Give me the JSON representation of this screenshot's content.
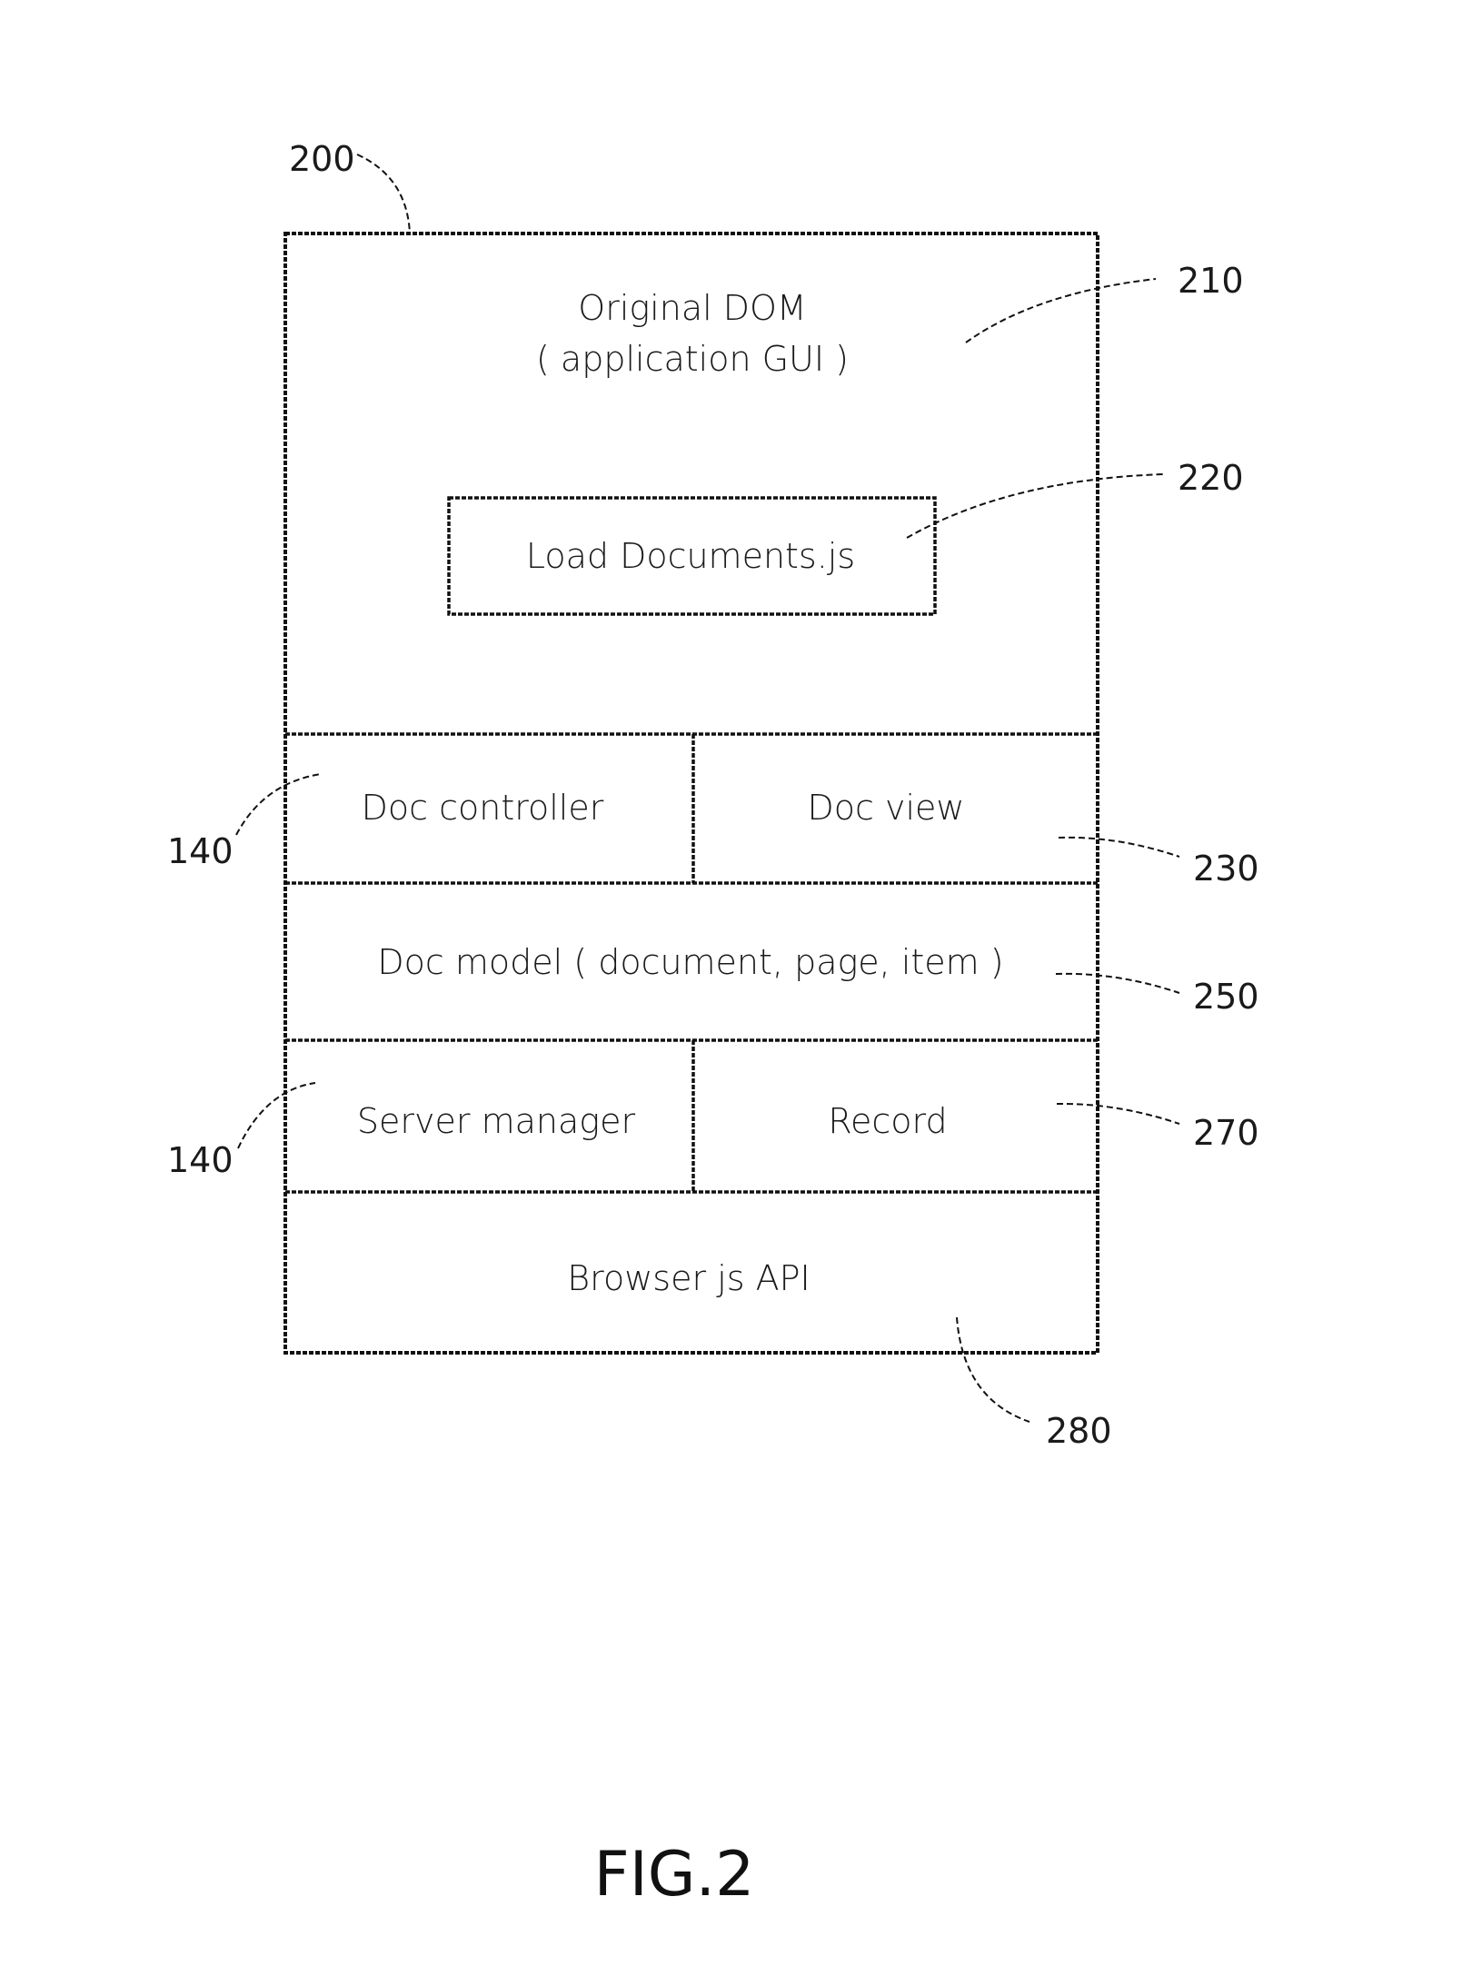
{
  "figure": {
    "caption": "FIG.2",
    "container_ref": "200",
    "original_dom": {
      "line1": "Original DOM",
      "line2": "( application GUI )",
      "ref": "210"
    },
    "load_documents": {
      "label": "Load Documents.js",
      "ref": "220"
    },
    "rows": {
      "doc_controller": {
        "label": "Doc controller",
        "ref": "140"
      },
      "doc_view": {
        "label": "Doc view",
        "ref": "230"
      },
      "doc_model": {
        "label": "Doc model ( document, page, item )",
        "ref": "250"
      },
      "server_manager": {
        "label": "Server manager",
        "ref": "140"
      },
      "record": {
        "label": "Record",
        "ref": "270"
      },
      "browser_api": {
        "label": "Browser js API",
        "ref": "280"
      }
    }
  }
}
